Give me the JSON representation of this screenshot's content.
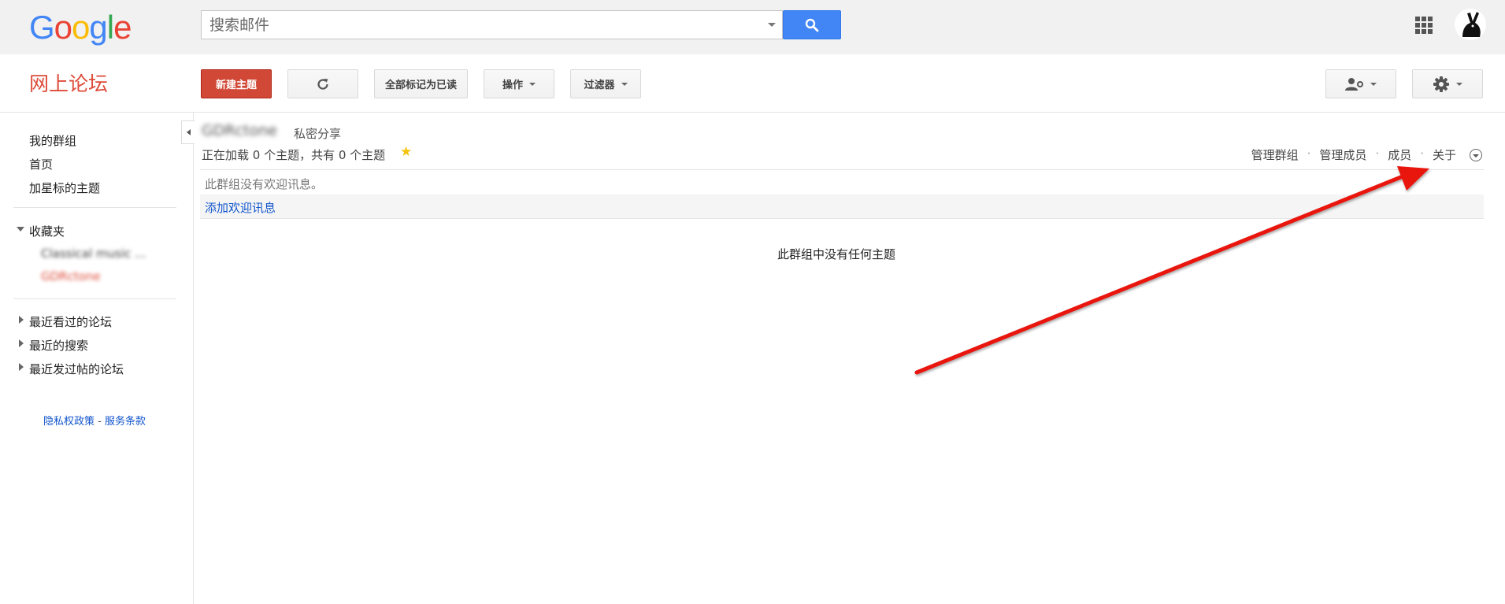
{
  "header": {
    "logo_letters": [
      {
        "ch": "G",
        "color": "#4285f4"
      },
      {
        "ch": "o",
        "color": "#ea4335"
      },
      {
        "ch": "o",
        "color": "#fbbc05"
      },
      {
        "ch": "g",
        "color": "#4285f4"
      },
      {
        "ch": "l",
        "color": "#34a853"
      },
      {
        "ch": "e",
        "color": "#ea4335"
      }
    ],
    "search_placeholder": "搜索邮件",
    "search_icon": "search-icon",
    "apps_icon": "apps-grid-icon",
    "avatar_icon": "avatar"
  },
  "toolbar": {
    "app_name": "网上论坛",
    "new_topic": "新建主题",
    "refresh_icon": "refresh-icon",
    "mark_all_read": "全部标记为已读",
    "actions": "操作",
    "filters": "过滤器",
    "member_settings_icon": "manage-people-icon",
    "settings_icon": "gear-icon",
    "accent_color": "#d14836"
  },
  "sidebar": {
    "my_groups": "我的群组",
    "home": "首页",
    "starred": "加星标的主题",
    "favorites": "收藏夹",
    "favorite_items": [
      "Classical music ...",
      "GDRctone"
    ],
    "recent_viewed": "最近看过的论坛",
    "recent_searches": "最近的搜索",
    "recent_posted": "最近发过帖的论坛",
    "privacy": "隐私权政策",
    "separator": "-",
    "terms": "服务条款"
  },
  "main": {
    "group_name": "GDRctone",
    "share_status": "私密分享",
    "status": "正在加载 0 个主题，共有 0 个主题",
    "links": [
      "管理群组",
      "管理成员",
      "成员",
      "关于"
    ],
    "no_welcome": "此群组没有欢迎讯息。",
    "add_welcome": "添加欢迎讯息",
    "no_topics": "此群组中没有任何主题"
  }
}
